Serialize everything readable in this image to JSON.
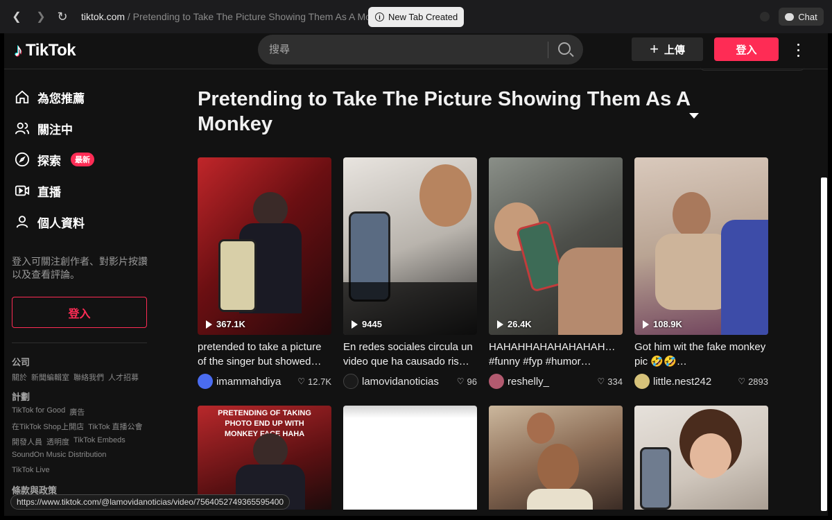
{
  "browser": {
    "domain": "tiktok.com",
    "path": " / Pretending to Take The Picture Showing Them As A Monkey",
    "new_tab_label": "New Tab Created",
    "chat_label": "Chat",
    "status_url": "https://www.tiktok.com/@lamovidanoticias/video/7564052749365595400"
  },
  "header": {
    "logo_text": "TikTok",
    "search_placeholder": "搜尋",
    "upload_label": "上傳",
    "login_label": "登入"
  },
  "sidebar": {
    "items": [
      {
        "label": "為您推薦",
        "icon": "home-icon"
      },
      {
        "label": "關注中",
        "icon": "users-icon"
      },
      {
        "label": "探索",
        "icon": "compass-icon",
        "badge": "最新"
      },
      {
        "label": "直播",
        "icon": "live-icon"
      },
      {
        "label": "個人資料",
        "icon": "profile-icon"
      }
    ],
    "login_prompt": "登入可關注創作者、對影片按讚以及查看評論。",
    "login_button": "登入",
    "footer": {
      "company_heading": "公司",
      "company_links": [
        "關於",
        "新聞編輯室",
        "聯絡我們",
        "人才招募"
      ],
      "programs_heading": "計劃",
      "programs_links_1": [
        "TikTok for Good",
        "廣告"
      ],
      "programs_links_2": [
        "在TikTok Shop上開店",
        "TikTok 直播公會"
      ],
      "programs_links_3": [
        "開發人員",
        "透明度",
        "TikTok Embeds"
      ],
      "programs_links_4": [
        "SoundOn Music Distribution"
      ],
      "programs_links_5": [
        "TikTok Live"
      ],
      "terms_heading": "條款與政策"
    }
  },
  "main": {
    "title": "Pretending to Take The Picture Showing Them As A Monkey",
    "videos": [
      {
        "views": "367.1K",
        "desc": "pretended to take a picture of the singer but showed…",
        "user": "imammahdiya",
        "likes": "12.7K"
      },
      {
        "views": "9445",
        "desc": "En redes sociales circula un video que ha causado ris…",
        "user": "lamovidanoticias",
        "likes": "96"
      },
      {
        "views": "26.4K",
        "desc": "HAHAHHAHAHAHAHAH… #funny #fyp #humor…",
        "user": "reshelly_",
        "likes": "334"
      },
      {
        "views": "108.9K",
        "desc": "Got him wit the fake monkey pic 🤣🤣…",
        "user": "little.nest242",
        "likes": "2893"
      }
    ],
    "row2_overlay_text": "PRETENDING OF TAKING PHOTO END UP WITH MONKEY FACE HAHA"
  },
  "colors": {
    "accent": "#fe2c55",
    "background": "#121212"
  }
}
